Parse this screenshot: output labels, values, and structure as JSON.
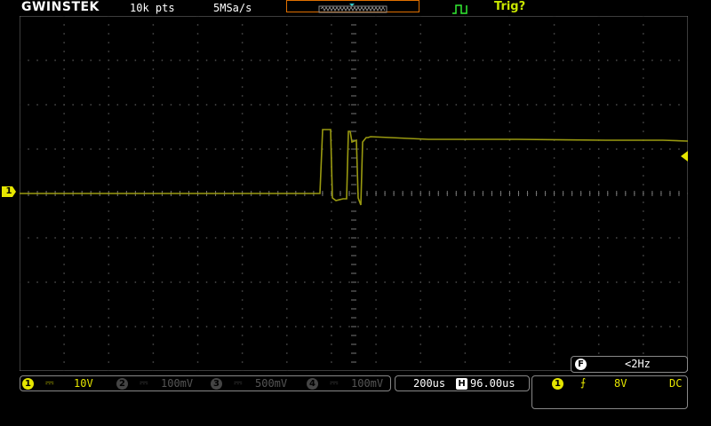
{
  "header": {
    "brand": "GWINSTEK",
    "memory_depth": "10k pts",
    "sample_rate": "5MSa/s",
    "trigger_status": "Trig?",
    "icons": [
      "memory-overview-icon",
      "trigger-waveform-icon"
    ]
  },
  "channels": [
    {
      "number": "1",
      "coupling_icon": "dc-coupling-icon",
      "scale": "10V",
      "active": true
    },
    {
      "number": "2",
      "coupling_icon": "dc-coupling-icon",
      "scale": "100mV",
      "active": false
    },
    {
      "number": "3",
      "coupling_icon": "dc-coupling-icon",
      "scale": "500mV",
      "active": false
    },
    {
      "number": "4",
      "coupling_icon": "dc-coupling-icon",
      "scale": "100mV",
      "active": false
    }
  ],
  "timebase": {
    "scale": "200us",
    "position": "96.00us",
    "position_icon": "horizontal-position-icon"
  },
  "trigger": {
    "source": "1",
    "slope_icon": "rising-edge-icon",
    "level": "8V",
    "coupling": "DC"
  },
  "frequency": {
    "icon_label": "F",
    "value": "<2Hz"
  },
  "markers": {
    "ch1_ground_label": "1"
  },
  "colors": {
    "background": "#000000",
    "channel1": "#e6e600",
    "trace": "#9a9a10",
    "grid": "#4a4a4a",
    "accent": "#e07000",
    "trig_status": "#c8e600"
  }
}
